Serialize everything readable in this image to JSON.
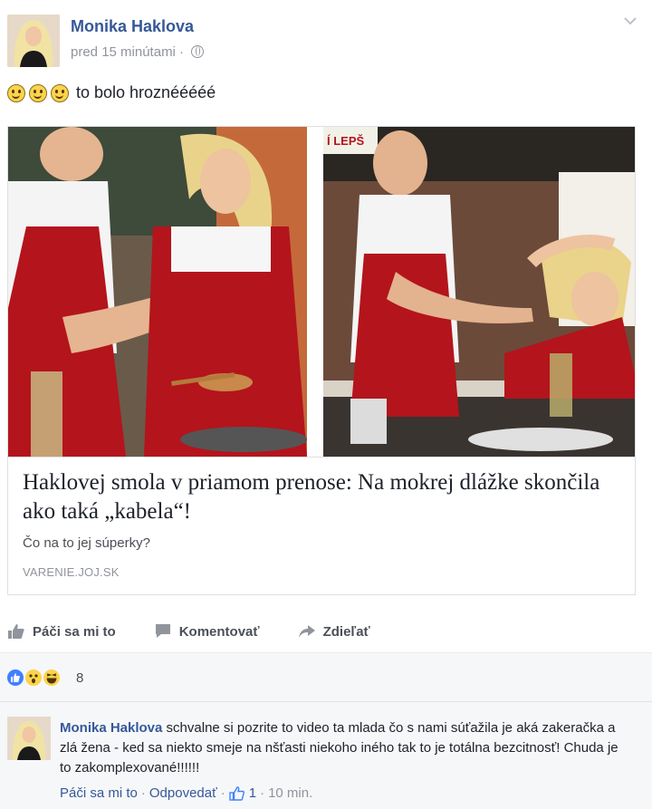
{
  "post": {
    "author": "Monika Haklova",
    "time": "pred 15 minútami ·",
    "text": "to bolo hroznééééé",
    "emoji_icons": [
      "smiley-icon",
      "smiley-icon",
      "smiley-icon"
    ]
  },
  "link": {
    "title": "Haklovej smola v priamom prenose: Na mokrej dlážke skončila ako taká „kabela“!",
    "description": "Čo na to jej súperky?",
    "domain": "VARENIE.JOJ.SK",
    "photo_sign_text": "Í LEPŠ"
  },
  "actions": {
    "like": "Páči sa mi to",
    "comment": "Komentovať",
    "share": "Zdieľať"
  },
  "reactions": {
    "icons": [
      "like-reaction-icon",
      "wow-reaction-icon",
      "haha-reaction-icon"
    ],
    "count": "8"
  },
  "comment": {
    "author": "Monika Haklova",
    "text": "schvalne si pozrite to video ta mlada čo s nami súťažila je aká zakeračka a zlá žena - ked sa niekto smeje na nšťasti niekoho iného tak to je totálna bezcitnosť! Chuda je to zakomplexované!!!!!!",
    "like_label": "Páči sa mi to",
    "reply_label": "Odpovedať",
    "like_count": "1",
    "time": "10 min."
  },
  "colors": {
    "link_blue": "#365899",
    "muted": "#90949c",
    "apron_red": "#b4141c"
  }
}
